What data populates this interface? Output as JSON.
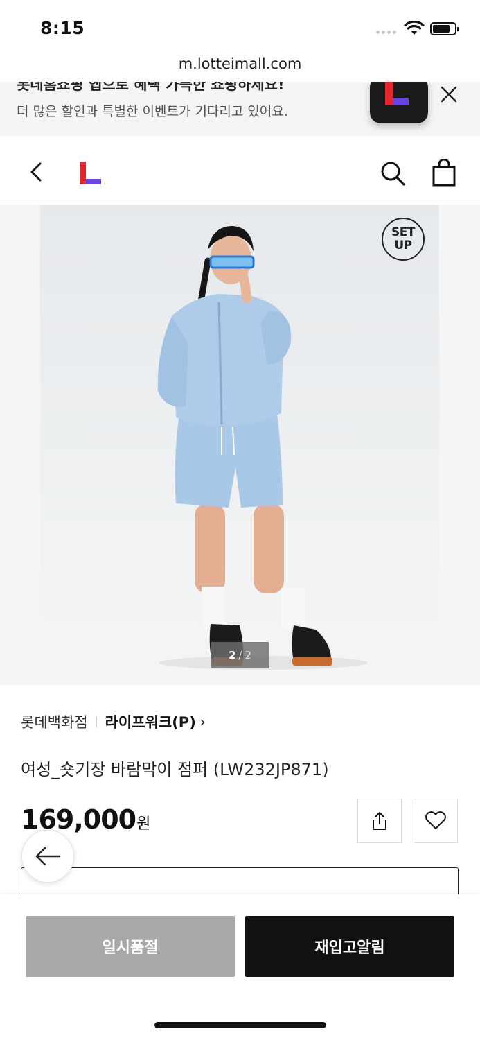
{
  "status_bar": {
    "time": "8:15"
  },
  "browser": {
    "url": "m.lotteimall.com"
  },
  "banner": {
    "line1": "롯데홈쇼핑 앱으로 혜택 가득한 쇼핑하세요!",
    "line2": "더 많은 할인과 특별한 이벤트가 기다리고 있어요."
  },
  "gallery": {
    "badge_line1": "SET",
    "badge_line2": "UP",
    "current": "2",
    "separator": "/",
    "total": "2"
  },
  "product": {
    "store": "롯데백화점",
    "brand": "라이프워크(P)",
    "brand_chevron": "›",
    "title": "여성_숏기장 바람막이 점퍼 (LW232JP871)",
    "price": "169,000",
    "price_unit": "원"
  },
  "actions": {
    "soldout_label": "일시품절",
    "restock_label": "재입고알림"
  },
  "colors": {
    "accent_red": "#e4252d",
    "accent_purple": "#6a43e6",
    "soldout_gray": "#a8a8a8",
    "primary_black": "#111111",
    "jacket_blue": "#a9c7e6"
  },
  "icons": [
    "back-icon",
    "logo",
    "search-icon",
    "cart-icon",
    "close-icon",
    "share-icon",
    "heart-icon",
    "arrow-left-icon"
  ]
}
